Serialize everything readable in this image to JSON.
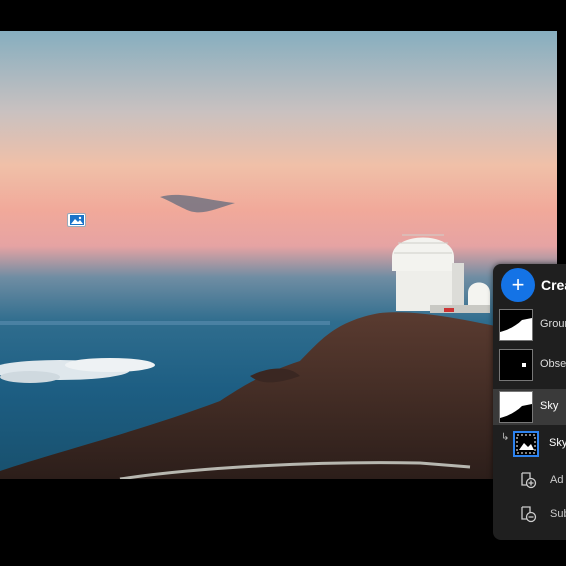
{
  "photo": {
    "description_icon": "image-icon"
  },
  "masks_panel": {
    "create_button_icon": "plus-icon",
    "create_label": "Crea",
    "masks": [
      {
        "label": "Groun"
      },
      {
        "label": "Obse"
      },
      {
        "label": "Sky"
      }
    ],
    "components": [
      {
        "label": "Sky"
      }
    ],
    "actions": [
      {
        "label": "Ad",
        "icon": "add-mask-icon"
      },
      {
        "label": "Sub",
        "icon": "subtract-mask-icon"
      }
    ]
  },
  "colors": {
    "accent": "#1473e6",
    "panel_bg": "#1f1f1f"
  }
}
